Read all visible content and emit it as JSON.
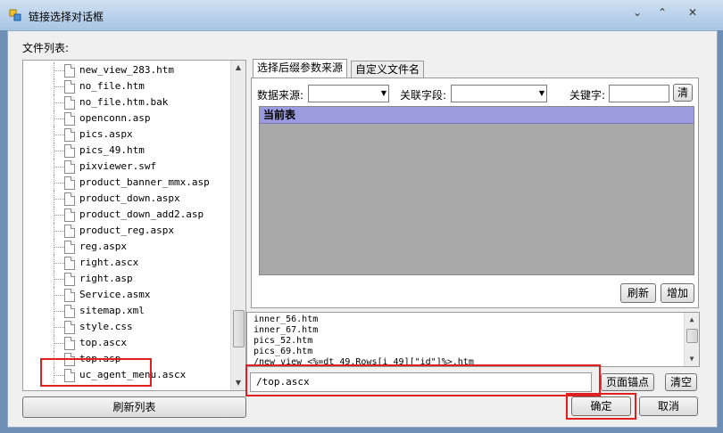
{
  "window": {
    "title": "链接选择对话框",
    "minimize": "⌄",
    "maximize": "⌃",
    "close": "✕"
  },
  "left": {
    "label": "文件列表:",
    "files": [
      "new_view_283.htm",
      "no_file.htm",
      "no_file.htm.bak",
      "openconn.asp",
      "pics.aspx",
      "pics_49.htm",
      "pixviewer.swf",
      "product_banner_mmx.asp",
      "product_down.aspx",
      "product_down_add2.asp",
      "product_reg.aspx",
      "reg.aspx",
      "right.ascx",
      "right.asp",
      "Service.asmx",
      "sitemap.xml",
      "style.css",
      "top.ascx",
      "top.asp",
      "uc_agent_menu.ascx"
    ],
    "selected": "top.ascx",
    "refresh_button": "刷新列表"
  },
  "tabs": [
    "选择后缀参数来源",
    "自定义文件名"
  ],
  "params": {
    "source_label": "数据来源:",
    "key_field_label": "关联字段:",
    "keyword_label": "关键字:",
    "clear_small": "清",
    "grid_header": "当前表",
    "refresh_button": "刷新",
    "add_button": "增加"
  },
  "result_lines": [
    "inner_56.htm",
    "inner_67.htm",
    "pics_52.htm",
    "pics_69.htm",
    "/new_view_<%=dt_49.Rows[i_49][\"id\"]%>.htm"
  ],
  "path_value": "/top.ascx",
  "buttons": {
    "anchor": "页面锚点",
    "clear": "清空",
    "ok": "确定",
    "cancel": "取消"
  }
}
